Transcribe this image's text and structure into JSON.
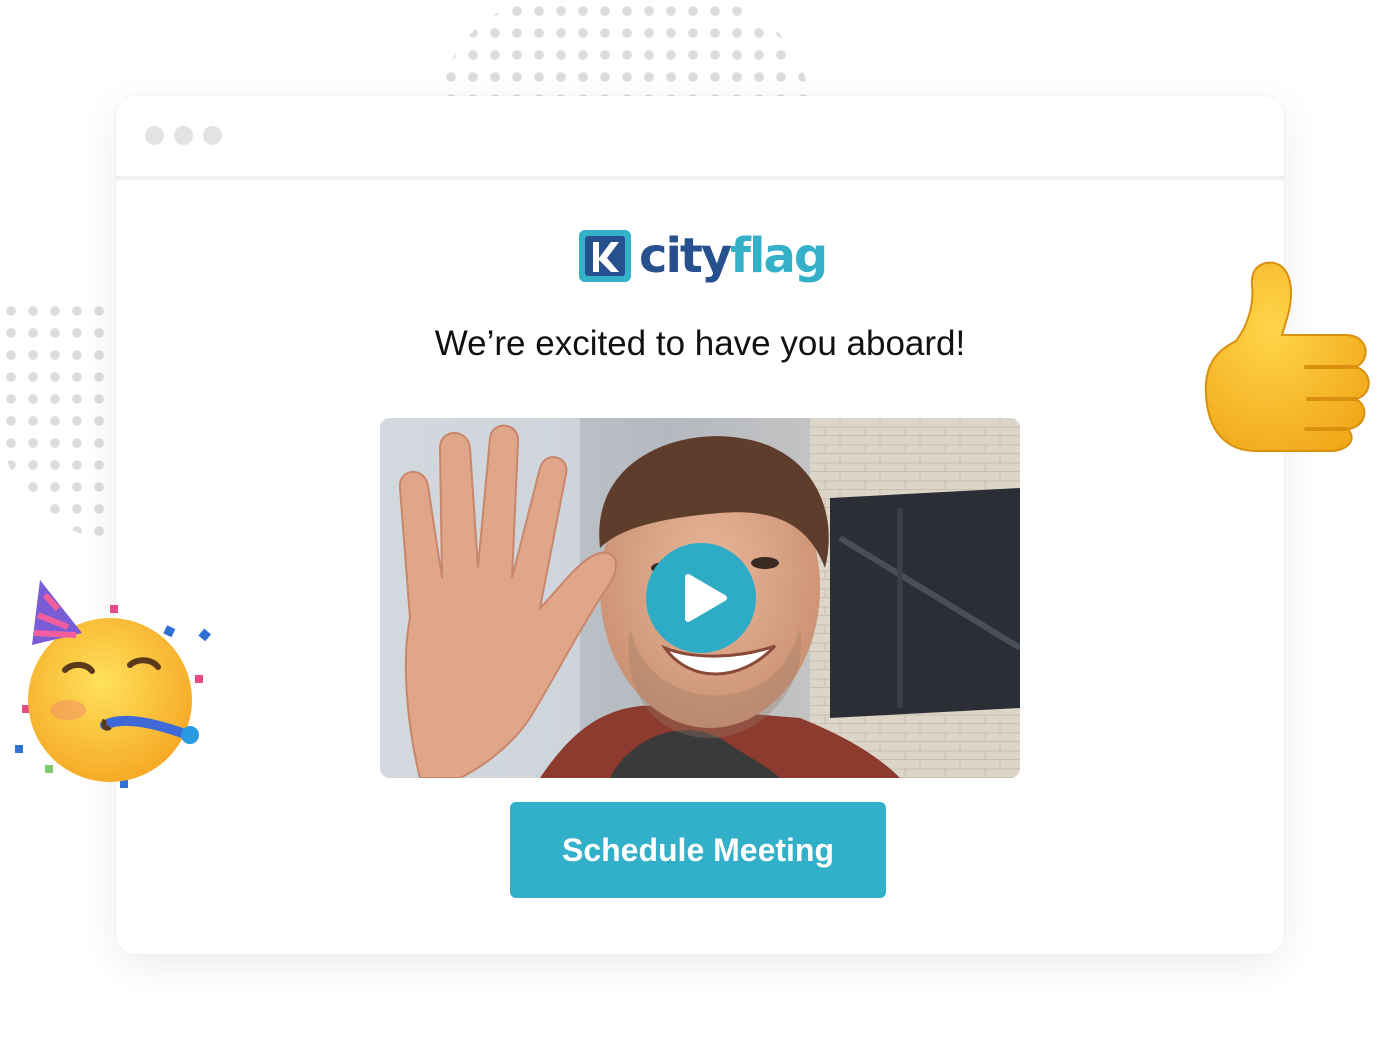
{
  "brand": {
    "name_part1": "city",
    "name_part2": "flag",
    "color_primary": "#27508f",
    "color_accent": "#34b0c9"
  },
  "window": {
    "controls": [
      "window-dot",
      "window-dot",
      "window-dot"
    ]
  },
  "main": {
    "headline": "We’re excited to have you aboard!",
    "video": {
      "play_icon": "play-icon"
    },
    "cta_label": "Schedule Meeting",
    "cta_color": "#33b0c9"
  },
  "decorations": {
    "left_emoji": "party-face-emoji",
    "right_emoji": "thumbs-up-emoji"
  }
}
